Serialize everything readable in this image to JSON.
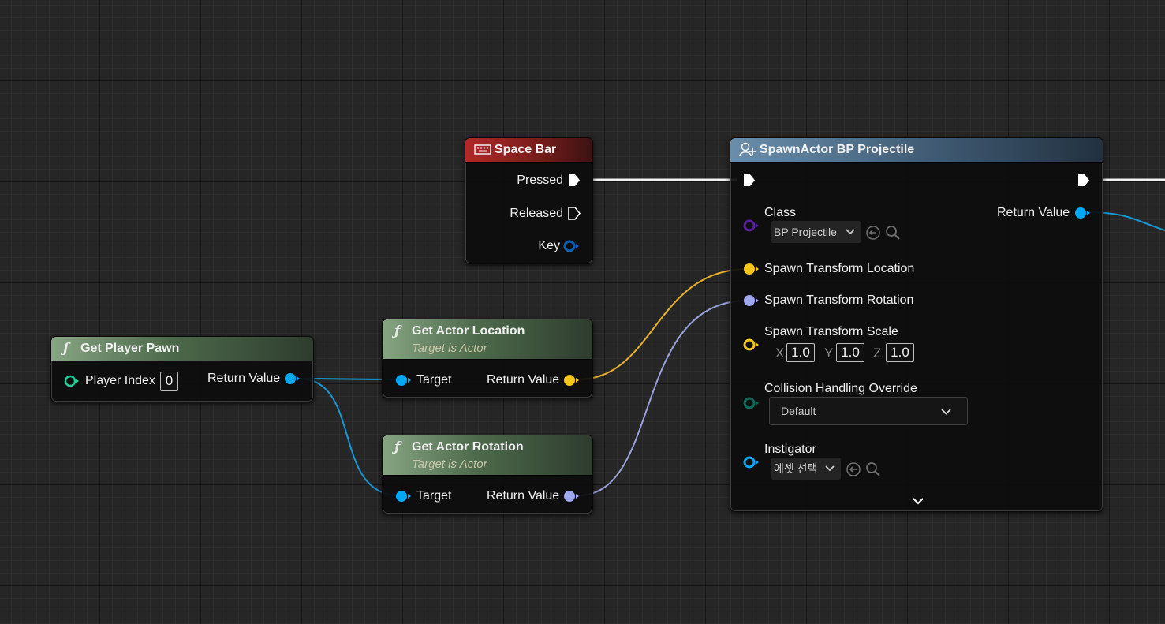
{
  "nodes": {
    "get_player_pawn": {
      "title": "Get Player Pawn",
      "player_index_label": "Player Index",
      "player_index_value": "0",
      "return_value_label": "Return Value"
    },
    "space_bar": {
      "title": "Space Bar",
      "pressed_label": "Pressed",
      "released_label": "Released",
      "key_label": "Key"
    },
    "get_actor_location": {
      "title": "Get Actor Location",
      "subtitle": "Target is Actor",
      "target_label": "Target",
      "return_value_label": "Return Value"
    },
    "get_actor_rotation": {
      "title": "Get Actor Rotation",
      "subtitle": "Target is Actor",
      "target_label": "Target",
      "return_value_label": "Return Value"
    },
    "spawn_actor": {
      "title": "SpawnActor BP Projectile",
      "class_label": "Class",
      "class_value": "BP Projectile",
      "return_value_label": "Return Value",
      "location_label": "Spawn Transform Location",
      "rotation_label": "Spawn Transform Rotation",
      "scale_label": "Spawn Transform Scale",
      "scale_x_axis": "X",
      "scale_x": "1.0",
      "scale_y_axis": "Y",
      "scale_y": "1.0",
      "scale_z_axis": "Z",
      "scale_z": "1.0",
      "collision_label": "Collision Handling Override",
      "collision_value": "Default",
      "instigator_label": "Instigator",
      "instigator_value": "에셋 선택"
    }
  },
  "icons": [
    "function-icon",
    "keyboard-icon",
    "spawn-actor-icon",
    "chevron-down-icon",
    "browse-arrow-icon",
    "search-icon",
    "exec-pin-icon",
    "data-pin-icon"
  ],
  "colors": {
    "exec": "#ffffff",
    "object_pin": "#00a8f3",
    "vector_pin": "#f5c518",
    "rotator_pin": "#9fa8ef",
    "class_pin": "#5a1ea0",
    "int_pin": "#1fcf9a",
    "struct_pin": "#0b4c8c",
    "enum_pin": "#0b6a5c"
  }
}
